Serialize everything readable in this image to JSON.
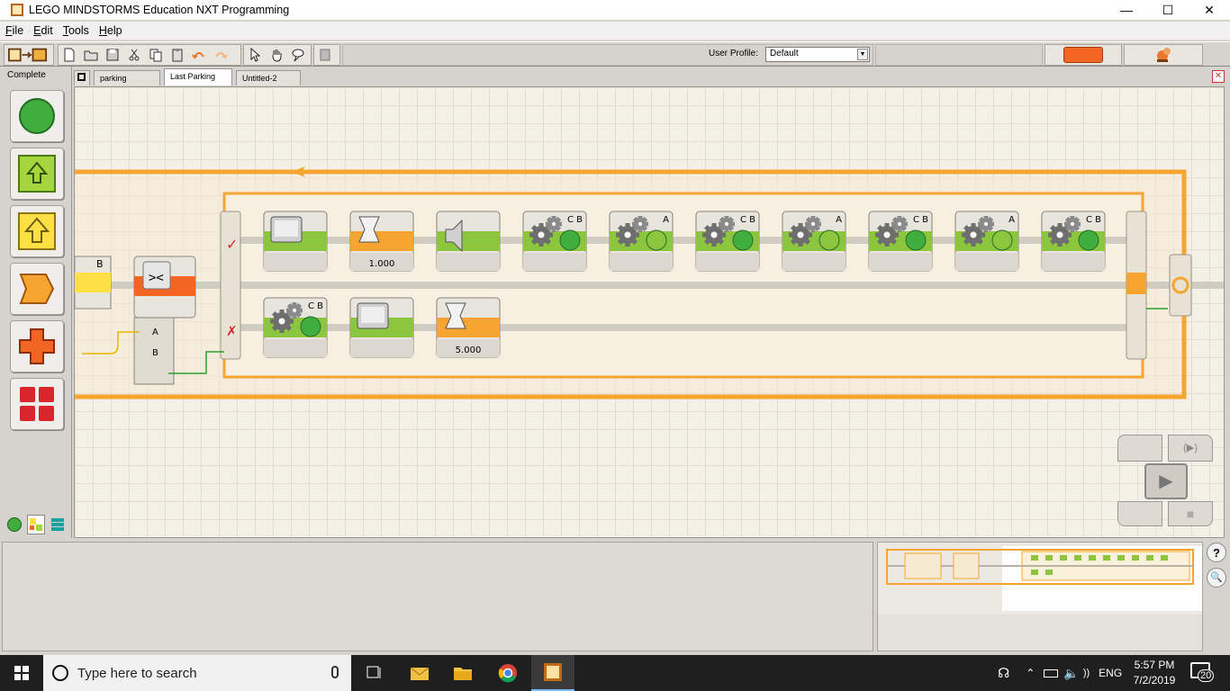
{
  "window": {
    "title": "LEGO MINDSTORMS Education NXT Programming",
    "min": "—",
    "max": "☐",
    "close": "✕"
  },
  "menu": [
    "File",
    "Edit",
    "Tools",
    "Help"
  ],
  "toolbar": {
    "profile_label": "User Profile:",
    "profile_value": "Default"
  },
  "palette": {
    "title": "Complete"
  },
  "tabs": [
    {
      "label": "parking",
      "active": false
    },
    {
      "label": "Last Parking",
      "active": true
    },
    {
      "label": "Untitled-2",
      "active": false
    }
  ],
  "program": {
    "partial_block_port": "B",
    "top_row": [
      {
        "type": "display",
        "label": ""
      },
      {
        "type": "wait",
        "label": "1.000"
      },
      {
        "type": "sound",
        "label": ""
      },
      {
        "type": "motor",
        "port": "C B",
        "label": ""
      },
      {
        "type": "motor",
        "port": "A",
        "label": ""
      },
      {
        "type": "motor",
        "port": "C B",
        "label": ""
      },
      {
        "type": "motor",
        "port": "A",
        "label": ""
      },
      {
        "type": "motor",
        "port": "C B",
        "label": ""
      },
      {
        "type": "motor",
        "port": "A",
        "label": ""
      },
      {
        "type": "motor",
        "port": "C B",
        "label": ""
      }
    ],
    "bottom_row": [
      {
        "type": "motor",
        "port": "C B",
        "label": ""
      },
      {
        "type": "display",
        "label": ""
      },
      {
        "type": "wait",
        "label": "5.000"
      }
    ],
    "compare_plugs": [
      "A",
      "B"
    ]
  },
  "controller": {
    "download_run": "▶",
    "stop": "■"
  },
  "side_buttons": {
    "help": "?",
    "zoom": "🔍"
  },
  "taskbar": {
    "search_placeholder": "Type here to search",
    "language": "ENG",
    "time": "5:57 PM",
    "date": "7/2/2019",
    "notifications": "20"
  },
  "colors": {
    "sequence_beam": "#f7a530",
    "action_green": "#8cc63f",
    "flow_orange": "#f26522",
    "sensor_yellow": "#fee94f"
  }
}
